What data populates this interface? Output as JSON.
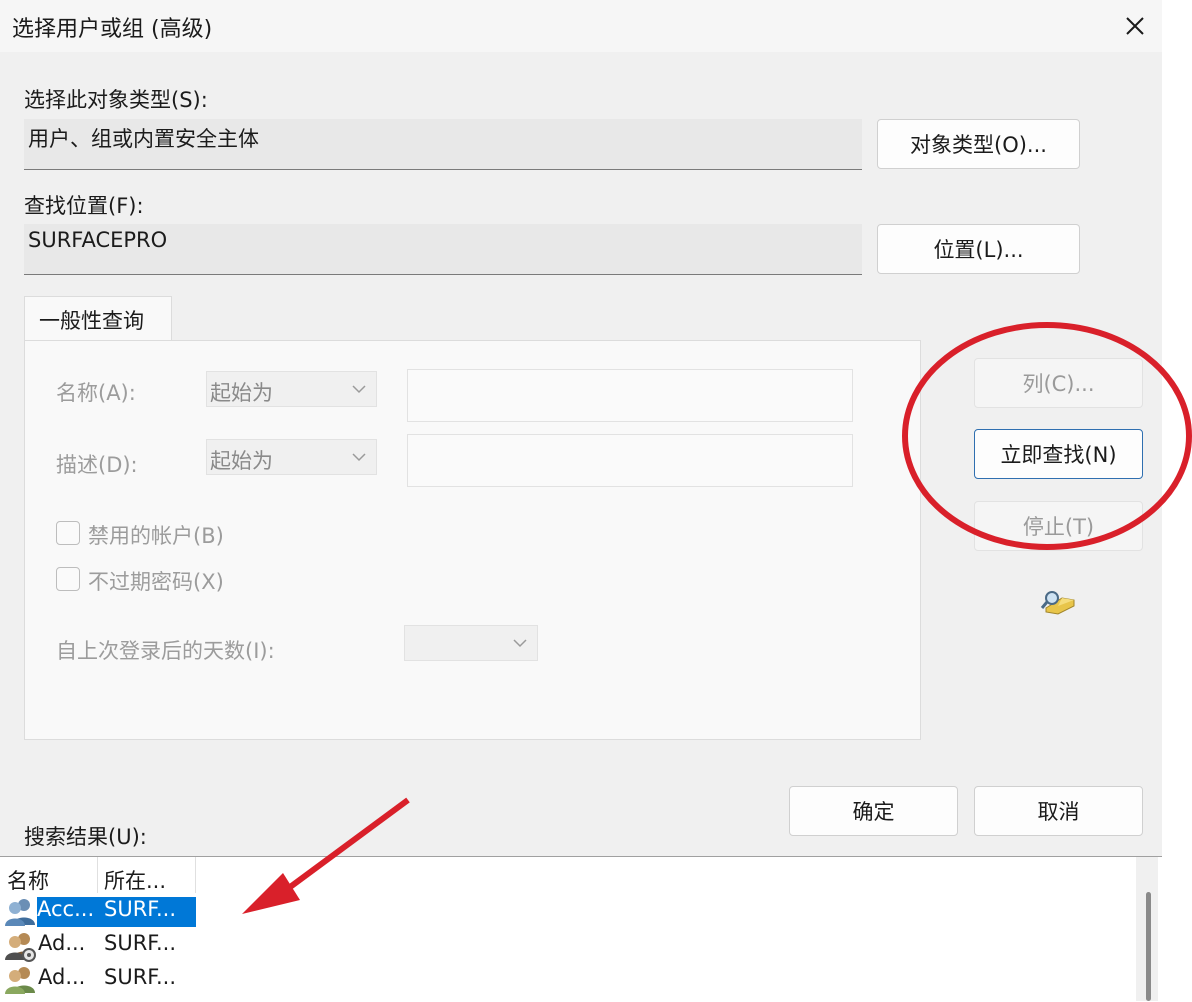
{
  "dialog": {
    "title": "选择用户或组 (高级)",
    "object_type_label": "选择此对象类型(S):",
    "object_type_value": "用户、组或内置安全主体",
    "object_type_button": "对象类型(O)...",
    "location_label": "查找位置(F):",
    "location_value": "SURFACEPRO",
    "location_button": "位置(L)..."
  },
  "query": {
    "tab_label": "一般性查询",
    "name_label": "名称(A):",
    "name_mode": "起始为",
    "desc_label": "描述(D):",
    "desc_mode": "起始为",
    "disabled_accounts_label": "禁用的帐户(B)",
    "non_expiring_password_label": "不过期密码(X)",
    "days_since_logon_label": "自上次登录后的天数(I):"
  },
  "side_buttons": {
    "columns": "列(C)...",
    "find_now": "立即查找(N)",
    "stop": "停止(T)"
  },
  "actions": {
    "ok": "确定",
    "cancel": "取消"
  },
  "results": {
    "label": "搜索结果(U):",
    "columns": [
      "名称",
      "所在..."
    ],
    "rows": [
      {
        "name": "Acc...",
        "location": "SURF...",
        "icon": "user-group-icon",
        "selected": true
      },
      {
        "name": "Ad...",
        "location": "SURF...",
        "icon": "user-group-gear-icon",
        "selected": false
      },
      {
        "name": "Ad...",
        "location": "SURF...",
        "icon": "user-group-icon",
        "selected": false
      }
    ]
  },
  "annotations": {
    "highlight_color": "#d9202a"
  }
}
